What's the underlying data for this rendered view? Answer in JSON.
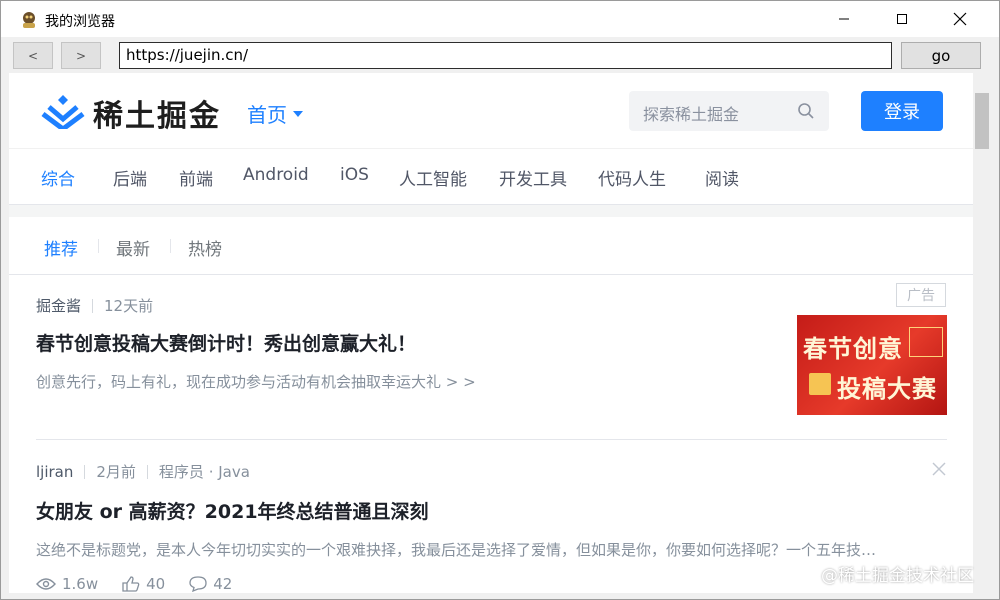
{
  "window": {
    "title": "我的浏览器"
  },
  "nav": {
    "back_label": "<",
    "forward_label": ">",
    "url": "https://juejin.cn/",
    "go_label": "go"
  },
  "site": {
    "logo_text": "稀土掘金",
    "home_menu": "首页",
    "search_placeholder": "探索稀土掘金",
    "login_label": "登录",
    "brand_color": "#1e80ff"
  },
  "categories": [
    "综合",
    "后端",
    "前端",
    "Android",
    "iOS",
    "人工智能",
    "开发工具",
    "代码人生",
    "阅读"
  ],
  "feed_tabs": [
    "推荐",
    "最新",
    "热榜"
  ],
  "entries": [
    {
      "author": "掘金酱",
      "time": "12天前",
      "badge": "广告",
      "title": "春节创意投稿大赛倒计时！秀出创意赢大礼！",
      "desc": "创意先行，码上有礼，现在成功参与活动有机会抽取幸运大礼 > >",
      "image_line1": "春节创意",
      "image_line2": "投稿大赛"
    },
    {
      "author": "ljiran",
      "time": "2月前",
      "tags": "程序员 · Java",
      "title": "女朋友 or 高薪资？2021年终总结普通且深刻",
      "desc": "这绝不是标题党，是本人今年切切实实的一个艰难抉择，我最后还是选择了爱情，但如果是你，你要如何选择呢？一个五年技…",
      "views": "1.6w",
      "likes": "40",
      "comments": "42"
    }
  ],
  "watermark": "@稀土掘金技术社区"
}
